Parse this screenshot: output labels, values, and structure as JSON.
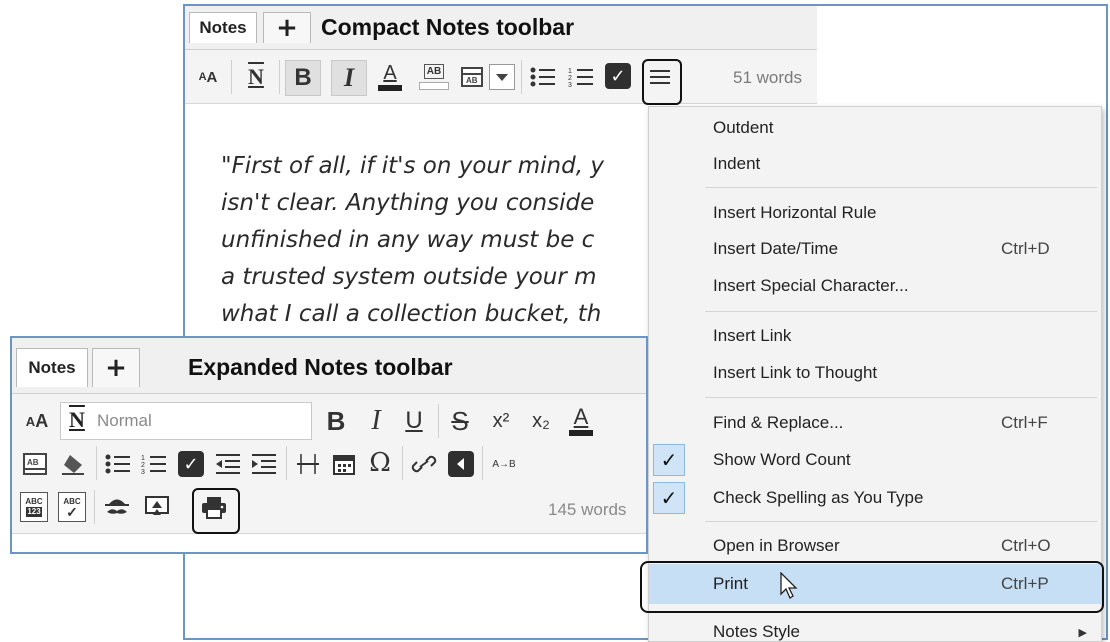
{
  "compact": {
    "tab_label": "Notes",
    "add_tab": "+",
    "title": "Compact Notes toolbar",
    "word_count": "51 words",
    "body_lines": [
      "\"First of all, if it's on your mind, y",
      "isn't clear. Anything you conside",
      "unfinished in any way must be c",
      "a trusted system outside your m",
      "what I call a collection bucket, th"
    ]
  },
  "menu": {
    "items": [
      {
        "label": "Outdent",
        "shortcut": ""
      },
      {
        "label": "Indent",
        "shortcut": ""
      },
      {
        "label": "Insert Horizontal Rule",
        "shortcut": ""
      },
      {
        "label": "Insert Date/Time",
        "shortcut": "Ctrl+D"
      },
      {
        "label": "Insert Special Character...",
        "shortcut": ""
      },
      {
        "label": "Insert Link",
        "shortcut": ""
      },
      {
        "label": "Insert Link to Thought",
        "shortcut": ""
      },
      {
        "label": "Find & Replace...",
        "shortcut": "Ctrl+F"
      },
      {
        "label": "Show Word Count",
        "shortcut": "",
        "checked": true
      },
      {
        "label": "Check Spelling as You Type",
        "shortcut": "",
        "checked": true
      },
      {
        "label": "Open in Browser",
        "shortcut": "Ctrl+O"
      },
      {
        "label": "Print",
        "shortcut": "Ctrl+P",
        "highlighted": true
      },
      {
        "label": "Notes Style",
        "shortcut": "",
        "submenu": true
      }
    ],
    "check_glyph": "✓",
    "submenu_glyph": "▶"
  },
  "expanded": {
    "tab_label": "Notes",
    "add_tab": "+",
    "title": "Expanded Notes toolbar",
    "style_value": "Normal",
    "word_count": "145 words"
  },
  "icons": {
    "font_size": "AA",
    "style": "N",
    "bold": "B",
    "italic": "I",
    "underline": "U",
    "strike": "S",
    "text_color": "A",
    "highlight": "AB",
    "spell_abc": "ABC",
    "spell_123": "123",
    "sort": "A→B",
    "omega": "Ω",
    "superscript": "x²",
    "subscript": "x₂",
    "check_glyph": "✓"
  },
  "colors": {
    "window_border": "#6b95c4",
    "menu_highlight": "#c7dff4",
    "check_bg": "#cfe4f7"
  }
}
